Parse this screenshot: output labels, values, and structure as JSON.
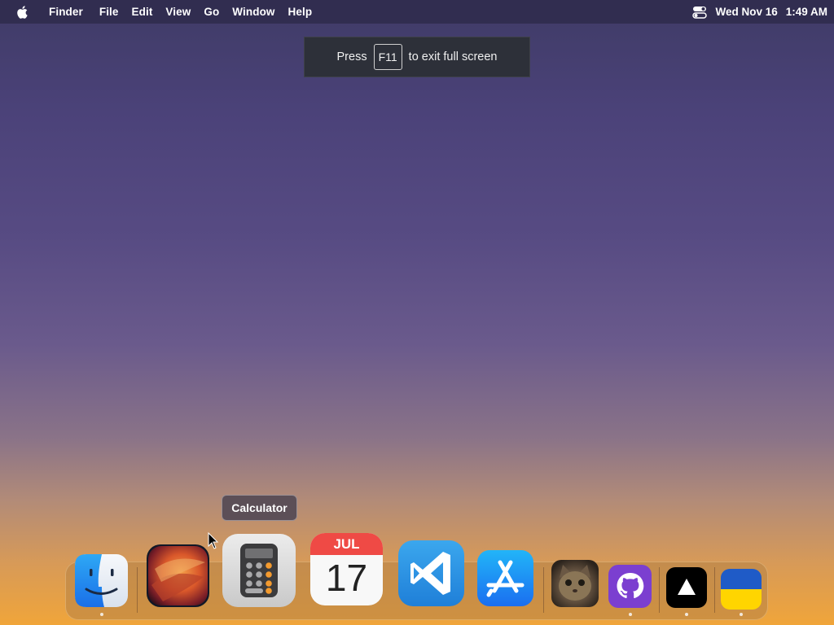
{
  "menubar": {
    "apple_icon": "apple-logo-icon",
    "app_name": "Finder",
    "items": [
      "File",
      "Edit",
      "View",
      "Go",
      "Window",
      "Help"
    ],
    "control_center_icon": "control-center-icon",
    "date": "Wed Nov 16",
    "time": "1:49 AM"
  },
  "fullscreen_banner": {
    "before": "Press",
    "key": "F11",
    "after": "to exit full screen"
  },
  "tooltip": {
    "label": "Calculator"
  },
  "dock": {
    "items": [
      {
        "name": "Finder",
        "icon": "finder-icon",
        "running": true
      },
      {
        "name": "macOS Ventura",
        "icon": "ventura-wallpaper-icon",
        "running": false
      },
      {
        "name": "Calculator",
        "icon": "calculator-icon",
        "running": false
      },
      {
        "name": "Calendar",
        "icon": "calendar-icon",
        "running": false,
        "month": "JUL",
        "day": "17"
      },
      {
        "name": "Visual Studio Code",
        "icon": "vscode-icon",
        "running": false
      },
      {
        "name": "App Store",
        "icon": "app-store-icon",
        "running": false
      },
      {
        "name": "Cat",
        "icon": "cat-photo-icon",
        "running": false
      },
      {
        "name": "GitHub",
        "icon": "github-icon",
        "running": true
      },
      {
        "name": "Vercel",
        "icon": "vercel-triangle-icon",
        "running": true
      },
      {
        "name": "Ukraine",
        "icon": "ukraine-flag-icon",
        "running": true
      }
    ]
  },
  "colors": {
    "menubar_bg": "#302c4e",
    "banner_bg": "#2d3039",
    "tooltip_bg": "#5c4f57"
  }
}
